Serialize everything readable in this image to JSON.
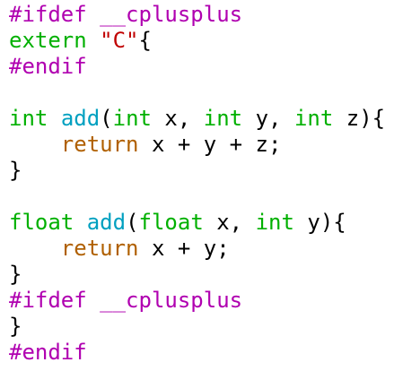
{
  "colors": {
    "preprocessor": "#b000b0",
    "type": "#00b000",
    "string": "#c00000",
    "function": "#00a0c0",
    "keyword": "#b06000",
    "plain": "#000000",
    "background": "#ffffff"
  },
  "lines": [
    [
      {
        "t": "#ifdef __cplusplus",
        "c": "preproc"
      }
    ],
    [
      {
        "t": "extern",
        "c": "type"
      },
      {
        "t": " ",
        "c": "plain"
      },
      {
        "t": "\"C\"",
        "c": "string"
      },
      {
        "t": "{",
        "c": "plain"
      }
    ],
    [
      {
        "t": "#endif",
        "c": "preproc"
      }
    ],
    [],
    [
      {
        "t": "int",
        "c": "type"
      },
      {
        "t": " ",
        "c": "plain"
      },
      {
        "t": "add",
        "c": "func"
      },
      {
        "t": "(",
        "c": "plain"
      },
      {
        "t": "int",
        "c": "type"
      },
      {
        "t": " x, ",
        "c": "plain"
      },
      {
        "t": "int",
        "c": "type"
      },
      {
        "t": " y, ",
        "c": "plain"
      },
      {
        "t": "int",
        "c": "type"
      },
      {
        "t": " z){",
        "c": "plain"
      }
    ],
    [
      {
        "t": "    ",
        "c": "plain"
      },
      {
        "t": "return",
        "c": "keyword"
      },
      {
        "t": " x + y + z;",
        "c": "plain"
      }
    ],
    [
      {
        "t": "}",
        "c": "plain"
      }
    ],
    [],
    [
      {
        "t": "float",
        "c": "type"
      },
      {
        "t": " ",
        "c": "plain"
      },
      {
        "t": "add",
        "c": "func"
      },
      {
        "t": "(",
        "c": "plain"
      },
      {
        "t": "float",
        "c": "type"
      },
      {
        "t": " x, ",
        "c": "plain"
      },
      {
        "t": "int",
        "c": "type"
      },
      {
        "t": " y){",
        "c": "plain"
      }
    ],
    [
      {
        "t": "    ",
        "c": "plain"
      },
      {
        "t": "return",
        "c": "keyword"
      },
      {
        "t": " x + y;",
        "c": "plain"
      }
    ],
    [
      {
        "t": "}",
        "c": "plain"
      }
    ],
    [
      {
        "t": "#ifdef __cplusplus",
        "c": "preproc"
      }
    ],
    [
      {
        "t": "}",
        "c": "plain"
      }
    ],
    [
      {
        "t": "#endif",
        "c": "preproc"
      }
    ]
  ]
}
